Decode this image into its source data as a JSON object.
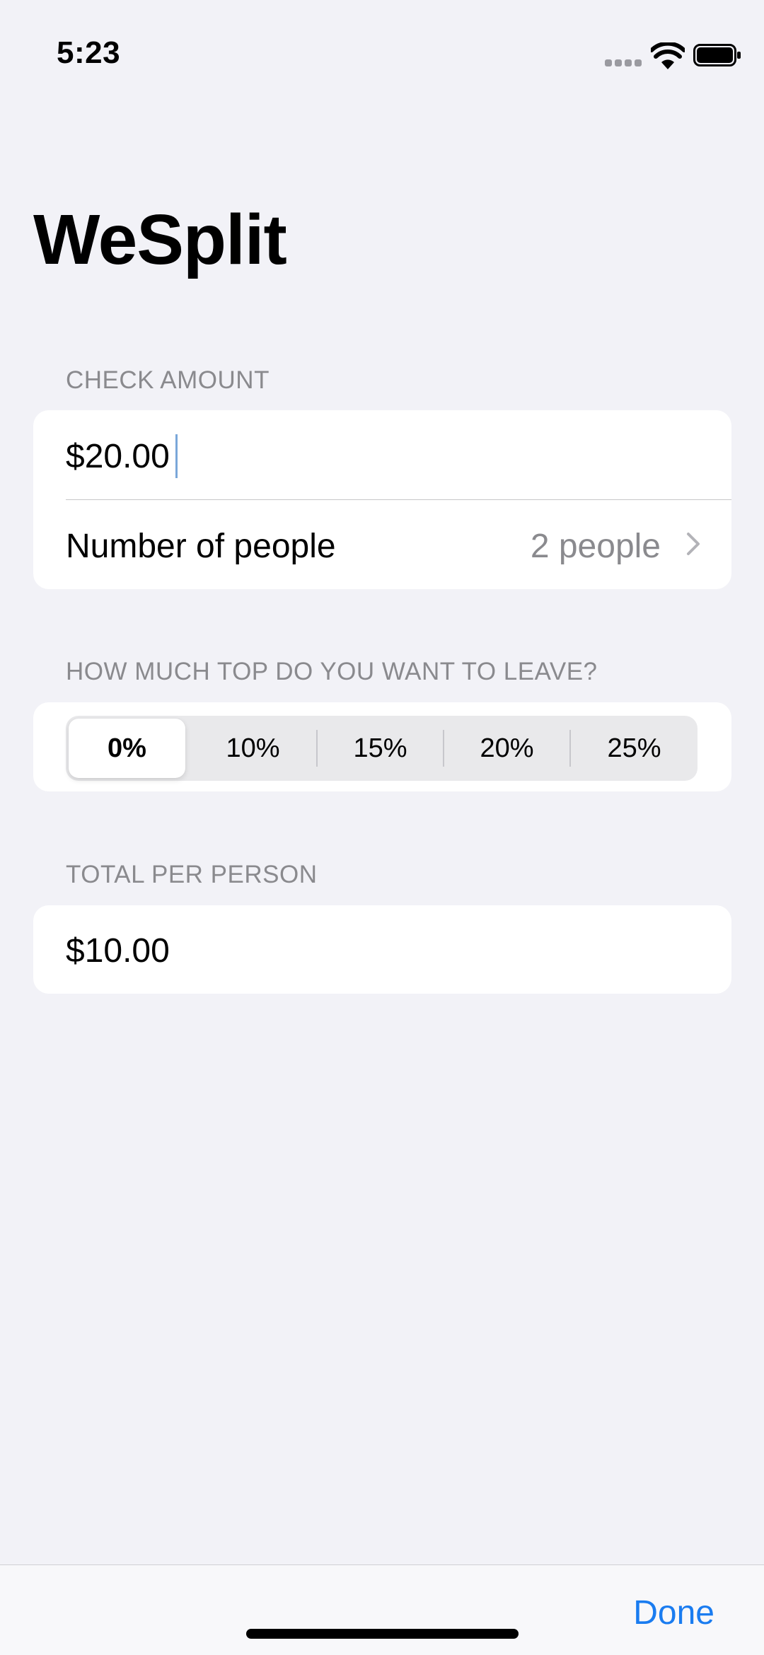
{
  "status_bar": {
    "time": "5:23",
    "icons": [
      "cellular-signal-icon",
      "wifi-icon",
      "battery-icon"
    ]
  },
  "nav": {
    "title": "WeSplit"
  },
  "check_amount": {
    "header": "CHECK AMOUNT",
    "amount_value": "$20.00",
    "people_label": "Number of people",
    "people_value": "2 people"
  },
  "tip": {
    "header": "HOW MUCH TOP DO YOU WANT TO LEAVE?",
    "options": [
      "0%",
      "10%",
      "15%",
      "20%",
      "25%"
    ],
    "selected": "0%"
  },
  "total": {
    "header": "TOTAL PER PERSON",
    "value": "$10.00"
  },
  "toolbar": {
    "done_label": "Done"
  },
  "colors": {
    "background": "#f2f2f7",
    "card": "#ffffff",
    "accent": "#1a7cf0",
    "secondary_text": "#8a8a8e"
  }
}
